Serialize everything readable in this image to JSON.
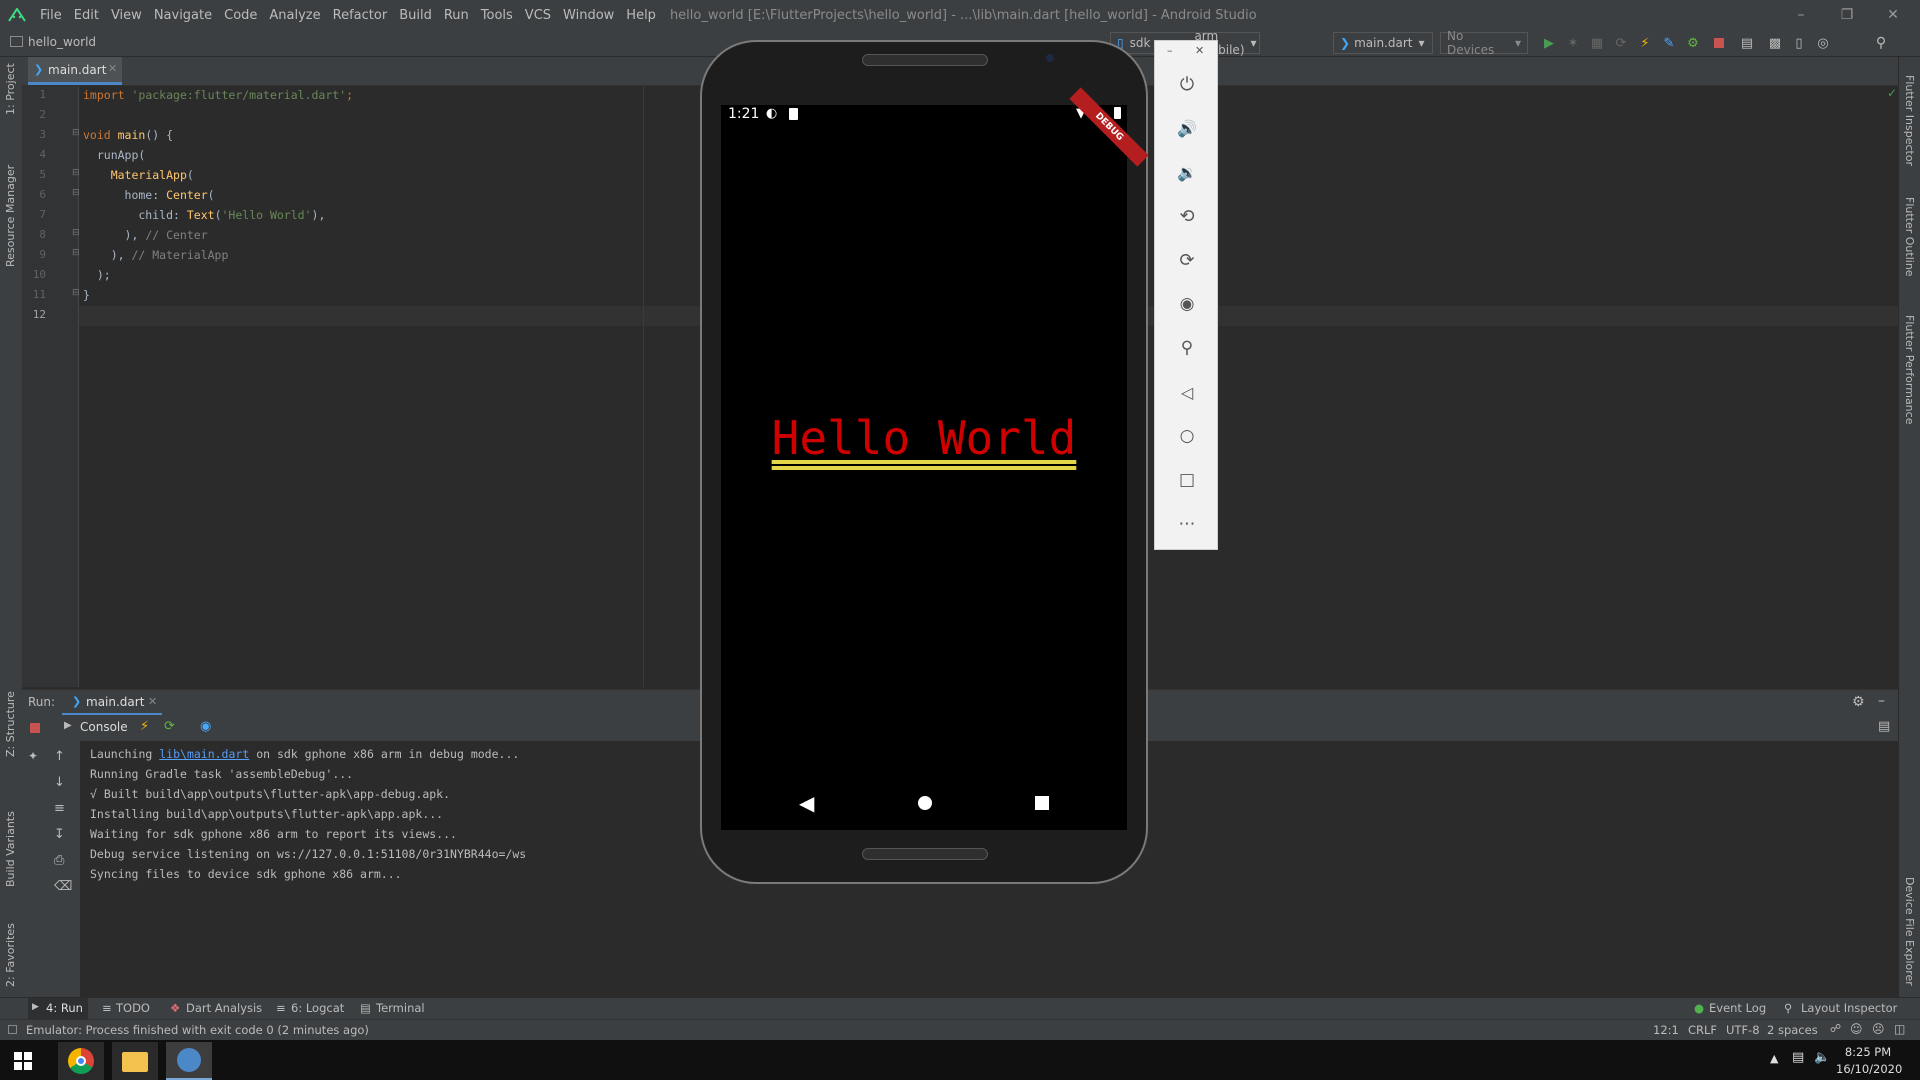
{
  "menu": {
    "items": [
      "File",
      "Edit",
      "View",
      "Navigate",
      "Code",
      "Analyze",
      "Refactor",
      "Build",
      "Run",
      "Tools",
      "VCS",
      "Window",
      "Help"
    ],
    "window_title": "hello_world [E:\\FlutterProjects\\hello_world] - ...\\lib\\main.dart [hello_world] - Android Studio"
  },
  "nav": {
    "project_name": "hello_world",
    "device_combo": "sdk",
    "device_combo_suffix": "arm (mobile)",
    "run_config": "main.dart",
    "devices_combo": "No Devices"
  },
  "left_stripe": {
    "project": "1: Project",
    "resource_manager": "Resource Manager",
    "structure": "Z: Structure",
    "build_variants": "Build Variants",
    "favorites": "2: Favorites"
  },
  "right_stripe": {
    "flutter_inspector": "Flutter Inspector",
    "flutter_outline": "Flutter Outline",
    "flutter_performance": "Flutter Performance",
    "device_file_explorer": "Device File Explorer"
  },
  "editor": {
    "tab_label": "main.dart",
    "line_numbers": [
      "1",
      "2",
      "3",
      "4",
      "5",
      "6",
      "7",
      "8",
      "9",
      "10",
      "11",
      "12"
    ],
    "lines": {
      "l1_kw": "import ",
      "l1_str": "'package:flutter/material.dart'",
      "l1_end": ";",
      "l3_kw": "void ",
      "l3_fn": "main",
      "l3_end": "() {",
      "l4": "  runApp(",
      "l5_fn": "MaterialApp",
      "l5_end": "(",
      "l6_a": "      home: ",
      "l6_fn": "Center",
      "l6_end": "(",
      "l7_a": "        child: ",
      "l7_fn": "Text",
      "l7_b": "(",
      "l7_str": "'Hello World'",
      "l7_end": "),",
      "l8_a": "      ), ",
      "l8_cmt": "// Center",
      "l9_a": "    ), ",
      "l9_cmt": "// MaterialApp",
      "l10": "  );",
      "l11": "}"
    }
  },
  "run_panel": {
    "title": "Run:",
    "tab_label": "main.dart",
    "console_tab": "Console",
    "output": [
      "Launching ",
      "lib\\main.dart",
      " on sdk gphone x86 arm in debug mode...",
      "Running Gradle task 'assembleDebug'...",
      "√ Built build\\app\\outputs\\flutter-apk\\app-debug.apk.",
      "Installing build\\app\\outputs\\flutter-apk\\app.apk...",
      "Waiting for sdk gphone x86 arm to report its views...",
      "Debug service listening on ws://127.0.0.1:51108/0r31NYBR44o=/ws",
      "Syncing files to device sdk gphone x86 arm..."
    ]
  },
  "bottom_tabs": {
    "run": "4: Run",
    "todo": "TODO",
    "dart_analysis": "Dart Analysis",
    "logcat": "6: Logcat",
    "terminal": "Terminal",
    "event_log": "Event Log",
    "layout_inspector": "Layout Inspector"
  },
  "status": {
    "message": "Emulator: Process finished with exit code 0 (2 minutes ago)",
    "position": "12:1",
    "line_sep": "CRLF",
    "encoding": "UTF-8",
    "indent": "2 spaces"
  },
  "phone": {
    "time": "1:21",
    "app_text": "Hello World",
    "debug_banner": "DEBUG"
  },
  "taskbar": {
    "clock_time": "8:25 PM",
    "clock_date": "16/10/2020"
  },
  "colors": {
    "app_text": "#d10000",
    "underline": "#e4d44a",
    "debug_banner": "#b41e1e"
  }
}
